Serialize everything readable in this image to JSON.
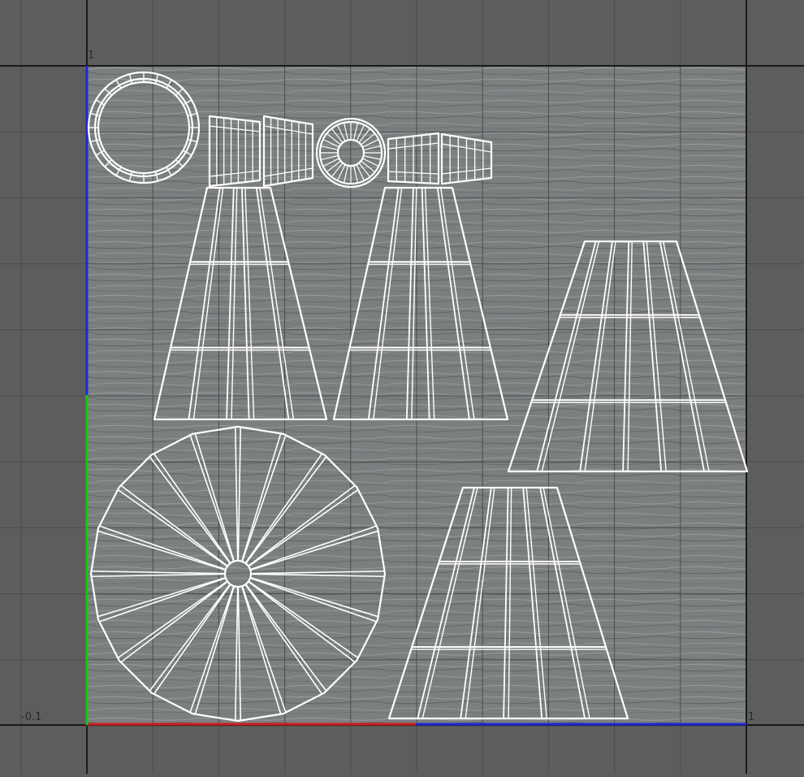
{
  "viewport": {
    "background_color": "#5d5d5d",
    "grid_color": "#4a4a4a",
    "uv_frame_color": "#1a1a1a"
  },
  "axis_labels": {
    "top_left_v": "1",
    "bottom_right_u": "1",
    "bottom_left_origin": "-0.1"
  },
  "axis_colors": {
    "u_axis_primary": "#d01c1c",
    "u_axis_secondary": "#1c2ad0",
    "v_axis_primary": "#19c519",
    "v_axis_secondary": "#1c2ad0"
  },
  "texture": {
    "name": "wood-plank-texture",
    "base_color": "#7c7f80"
  },
  "uv_islands": {
    "wire_color": "#ffffff",
    "items": [
      "ring-island",
      "small-frustum-island-1",
      "small-frustum-island-2",
      "small-disc-island",
      "small-frustum-island-3",
      "small-frustum-island-4",
      "tall-frustum-island-1",
      "tall-frustum-island-2",
      "right-frustum-island",
      "large-disc-island",
      "bottom-frustum-island"
    ]
  }
}
